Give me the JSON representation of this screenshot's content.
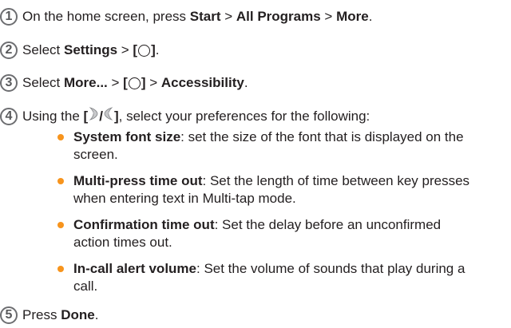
{
  "steps": [
    {
      "number": "1",
      "pre": "On the home screen, press ",
      "b1": "Start",
      "mid1": " > ",
      "b2": "All Programs",
      "mid2": " > ",
      "b3": "More",
      "post": "."
    },
    {
      "number": "2",
      "pre": "Select ",
      "b1": "Settings",
      "mid1": " > ",
      "bracket_open": "[",
      "bracket_close": "]",
      "post": "."
    },
    {
      "number": "3",
      "pre": "Select ",
      "b1": "More...",
      "mid1": " > ",
      "bracket_open": "[",
      "bracket_close": "]",
      "mid2": " > ",
      "b2": "Accessibility",
      "post": "."
    },
    {
      "number": "4",
      "pre": "Using the ",
      "bracket_open": "[",
      "slash": "/",
      "bracket_close": "]",
      "post": ", select your preferences for the following:"
    },
    {
      "number": "5",
      "pre": "Press ",
      "b1": "Done",
      "post": "."
    }
  ],
  "bullets": [
    {
      "term": "System font size",
      "line1": ": set the size of the font that is displayed on the",
      "line2": "screen."
    },
    {
      "term": "Multi-press time out",
      "line1": ": Set the length of time between key presses",
      "line2": "when entering text in Multi-tap mode."
    },
    {
      "term": "Confirmation time out",
      "line1": ": Set the delay before an unconfirmed",
      "line2": "action times out."
    },
    {
      "term": "In-call alert volume",
      "line1": ": Set the volume of sounds that play during a",
      "line2": "call."
    }
  ],
  "colors": {
    "bullet": "#f7941d",
    "text": "#231f20",
    "step_number_ring": "#6d6e71"
  },
  "icons": {
    "center_key": "circle-key-icon",
    "volume_keys": "volume-keys-icon"
  }
}
